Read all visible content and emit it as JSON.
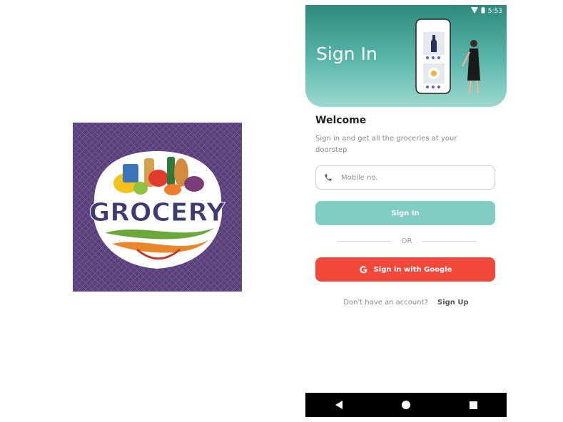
{
  "app_icon": {
    "logo_text": "GROCERY",
    "icon_name": "grocery-logo-icon",
    "background_color": "#5a3f7a"
  },
  "status_bar": {
    "time": "5:53",
    "icons": [
      "wifi-icon",
      "battery-icon"
    ]
  },
  "header": {
    "title": "Sign In",
    "gradient": [
      "#2f8a7e",
      "#9ed8cf"
    ]
  },
  "welcome": {
    "title": "Welcome",
    "subtitle": "Sign in and get all the groceries at your doorstep"
  },
  "mobile_field": {
    "placeholder": "Mobile no.",
    "icon": "phone-icon"
  },
  "signin_button": {
    "label": "Sign In",
    "color": "#7fcdc3"
  },
  "divider": {
    "label": "OR"
  },
  "google_button": {
    "label": "Sign in with Google",
    "icon": "google-icon",
    "color": "#f1483a"
  },
  "signup": {
    "prompt": "Don't have an account?",
    "link": "Sign Up"
  },
  "nav_bar": {
    "buttons": [
      "back-icon",
      "home-icon",
      "recents-icon"
    ]
  }
}
